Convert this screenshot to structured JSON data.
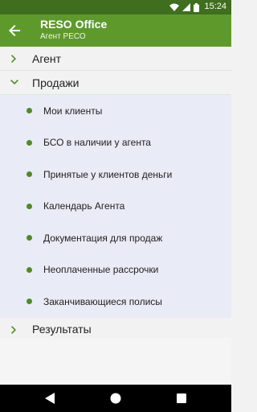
{
  "status_bar": {
    "time": "15:24",
    "icons": [
      "wifi-icon",
      "signal-icon",
      "battery-icon"
    ]
  },
  "app_bar": {
    "title": "RESO Office",
    "subtitle": "Агент РЕСО"
  },
  "menu": {
    "groups": [
      {
        "label": "Агент",
        "expanded": false
      },
      {
        "label": "Продажи",
        "expanded": true,
        "items": [
          "Мои клиенты",
          "БСО в наличии у агента",
          "Принятые у клиентов деньги",
          "Календарь Агента",
          "Документация для продаж",
          "Неоплаченные рассрочки",
          "Заканчивающиеся полисы"
        ]
      },
      {
        "label": "Результаты",
        "expanded": false
      }
    ]
  },
  "colors": {
    "app_bar": "#5e9a2b",
    "status_bar": "#3f6e1e",
    "accent": "#4e8b26",
    "submenu_bg": "#e9ebf6"
  }
}
